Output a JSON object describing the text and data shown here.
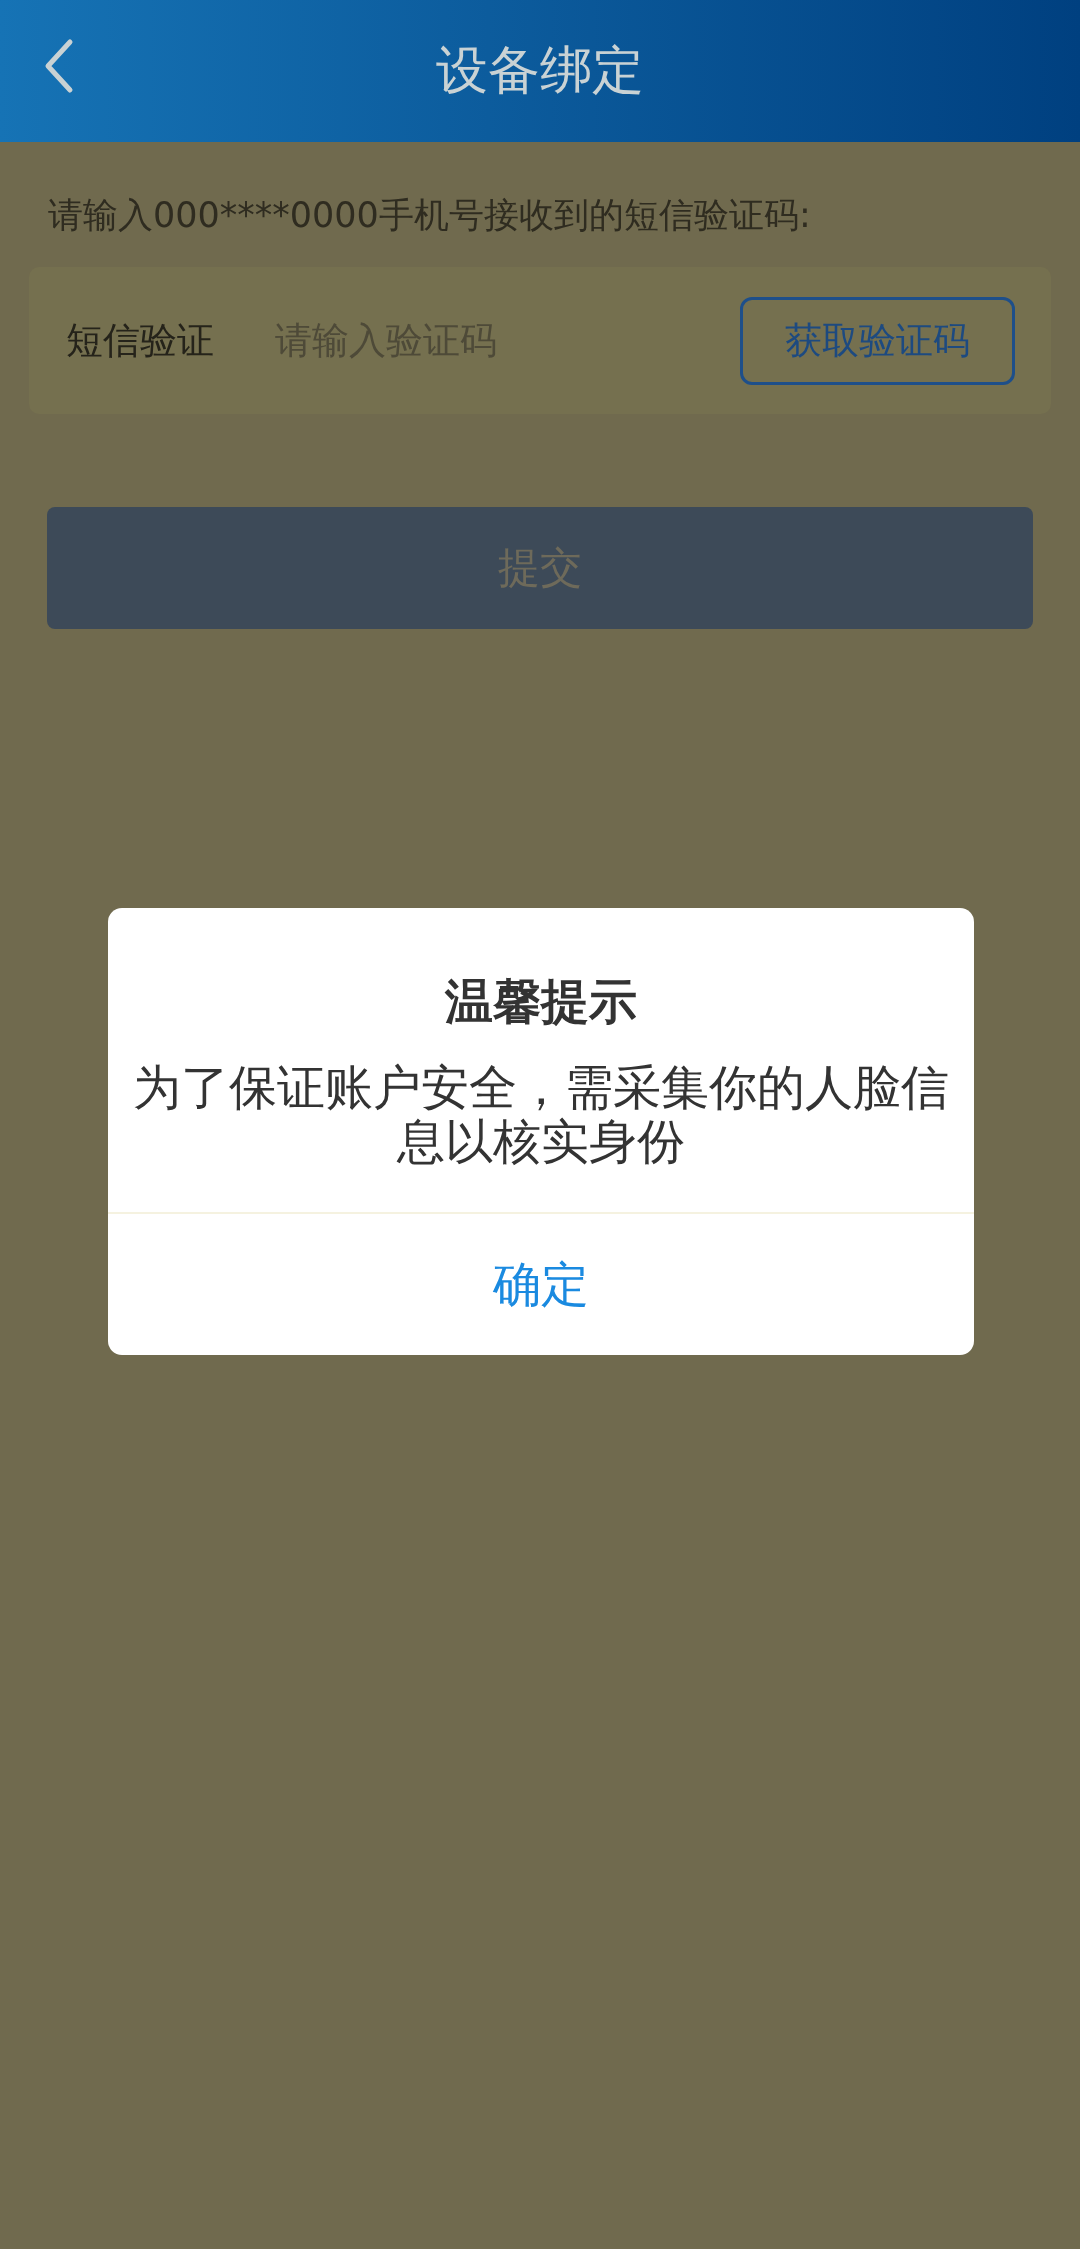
{
  "header": {
    "title": "设备绑定"
  },
  "hint": "请输入000****0000手机号接收到的短信验证码:",
  "sms_field": {
    "label": "短信验证",
    "placeholder": "请输入验证码"
  },
  "get_code_button": "获取验证码",
  "submit_button": "提交",
  "dialog": {
    "title": "温馨提示",
    "message": "为了保证账户安全，需采集你的人脸信息以核实身份",
    "confirm_button": "确定"
  }
}
